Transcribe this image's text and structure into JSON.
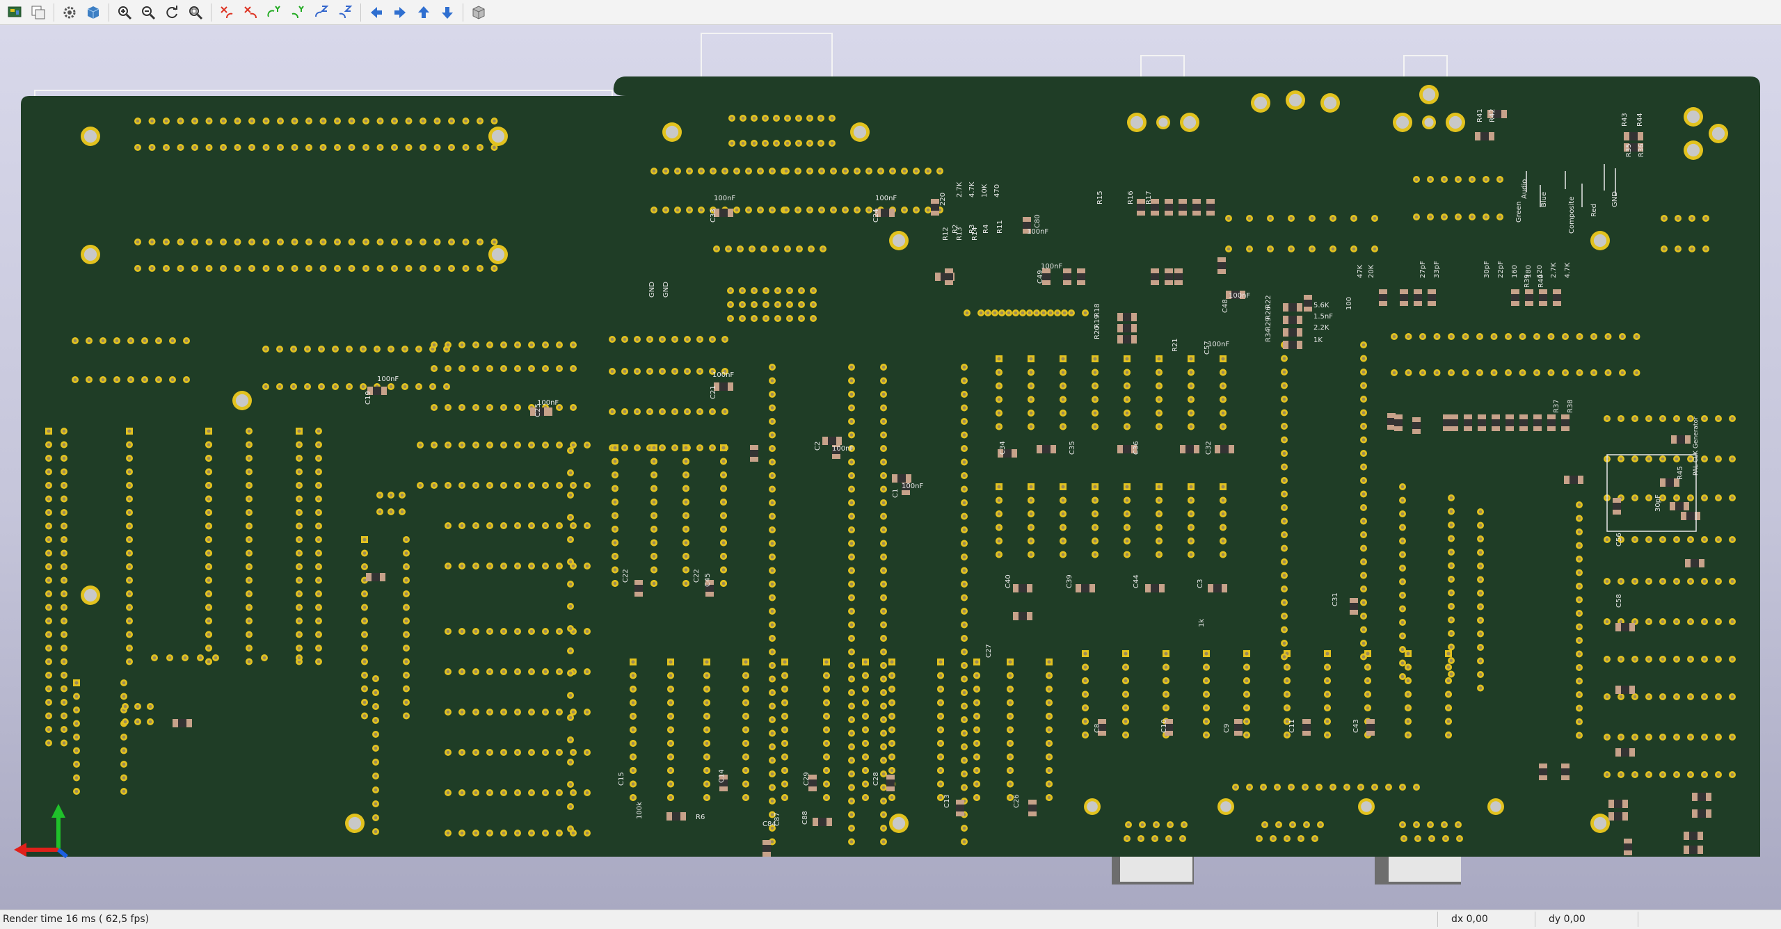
{
  "toolbar": {
    "buttons": [
      {
        "name": "pcb-editor",
        "icon": "pcb-editor-icon"
      },
      {
        "name": "copy-3d-image",
        "icon": "copy-icon"
      },
      {
        "name": "preferences",
        "icon": "gear-icon"
      },
      {
        "name": "raytracing",
        "icon": "raytrace-cube-icon"
      },
      {
        "name": "zoom-in",
        "icon": "zoom-in-icon"
      },
      {
        "name": "zoom-out",
        "icon": "zoom-out-icon"
      },
      {
        "name": "redraw",
        "icon": "refresh-icon"
      },
      {
        "name": "zoom-fit",
        "icon": "zoom-fit-icon"
      },
      {
        "name": "rotate-x-cw",
        "icon": "rotate-x-icon"
      },
      {
        "name": "rotate-x-ccw",
        "icon": "rotate-x-ccw-icon"
      },
      {
        "name": "rotate-y-cw",
        "icon": "rotate-y-icon"
      },
      {
        "name": "rotate-y-ccw",
        "icon": "rotate-y-ccw-icon"
      },
      {
        "name": "rotate-z-cw",
        "icon": "rotate-z-icon"
      },
      {
        "name": "rotate-z-ccw",
        "icon": "rotate-z-ccw-icon"
      },
      {
        "name": "move-left",
        "icon": "arrow-left-icon"
      },
      {
        "name": "move-right",
        "icon": "arrow-right-icon"
      },
      {
        "name": "move-up",
        "icon": "arrow-up-icon"
      },
      {
        "name": "move-down",
        "icon": "arrow-down-icon"
      },
      {
        "name": "ortho-view",
        "icon": "ortho-cube-icon"
      }
    ]
  },
  "colors": {
    "board": "#1f3d26",
    "pad": "#e2c21e",
    "silk": "#e8e8e8"
  },
  "status": {
    "render_time": "Render time 16 ms ( 62,5 fps)",
    "dx": "dx 0,00",
    "dy": "dy 0,00"
  },
  "board_labels": {
    "connector_labels": [
      "Audio",
      "Green",
      "Blue",
      "Composite",
      "Red",
      "GND"
    ],
    "pal_label": "PAL CLK Generator",
    "caps": [
      "100nF",
      "100nF",
      "100nF",
      "100nF",
      "100nF",
      "100nF",
      "100nF",
      "100nF",
      "100nF",
      "100nF",
      "100nF",
      "100nF",
      "100nF",
      "100nF",
      "100nF"
    ],
    "cap_refs": [
      "C33",
      "C24",
      "C80",
      "C49",
      "C48",
      "C57",
      "C21",
      "C19",
      "C25",
      "C2",
      "C1",
      "C22",
      "C22",
      "C45",
      "C34",
      "C35",
      "C36",
      "C32",
      "C40",
      "C39",
      "C44",
      "C3",
      "C27",
      "C31",
      "C15",
      "C14",
      "C13",
      "C26",
      "C29",
      "C28",
      "C8",
      "C10",
      "C9",
      "C11",
      "C43",
      "C56",
      "C58"
    ],
    "res_labels": [
      "R2",
      "R3",
      "R4",
      "R11",
      "R12",
      "R13",
      "R14",
      "R15",
      "R16",
      "R17",
      "R18",
      "R19",
      "R20",
      "R21",
      "R22",
      "R26",
      "R29",
      "R34",
      "R37",
      "R38",
      "R39",
      "R40",
      "R41",
      "R42",
      "R43",
      "R44",
      "R45"
    ],
    "values": [
      "2.7K",
      "4.7K",
      "10K",
      "470",
      "220",
      "5.6K",
      "1.5nF",
      "2.2K",
      "1K",
      "100",
      "47K",
      "20K",
      "27pF",
      "33pF",
      "30pF",
      "22pF",
      "160",
      "180",
      "120"
    ],
    "gnd_labels": [
      "GND",
      "GND"
    ],
    "misc": [
      "100k",
      "R6",
      "C84",
      "C87",
      "C88",
      "R35",
      "R36",
      "1k",
      "30pF"
    ]
  }
}
